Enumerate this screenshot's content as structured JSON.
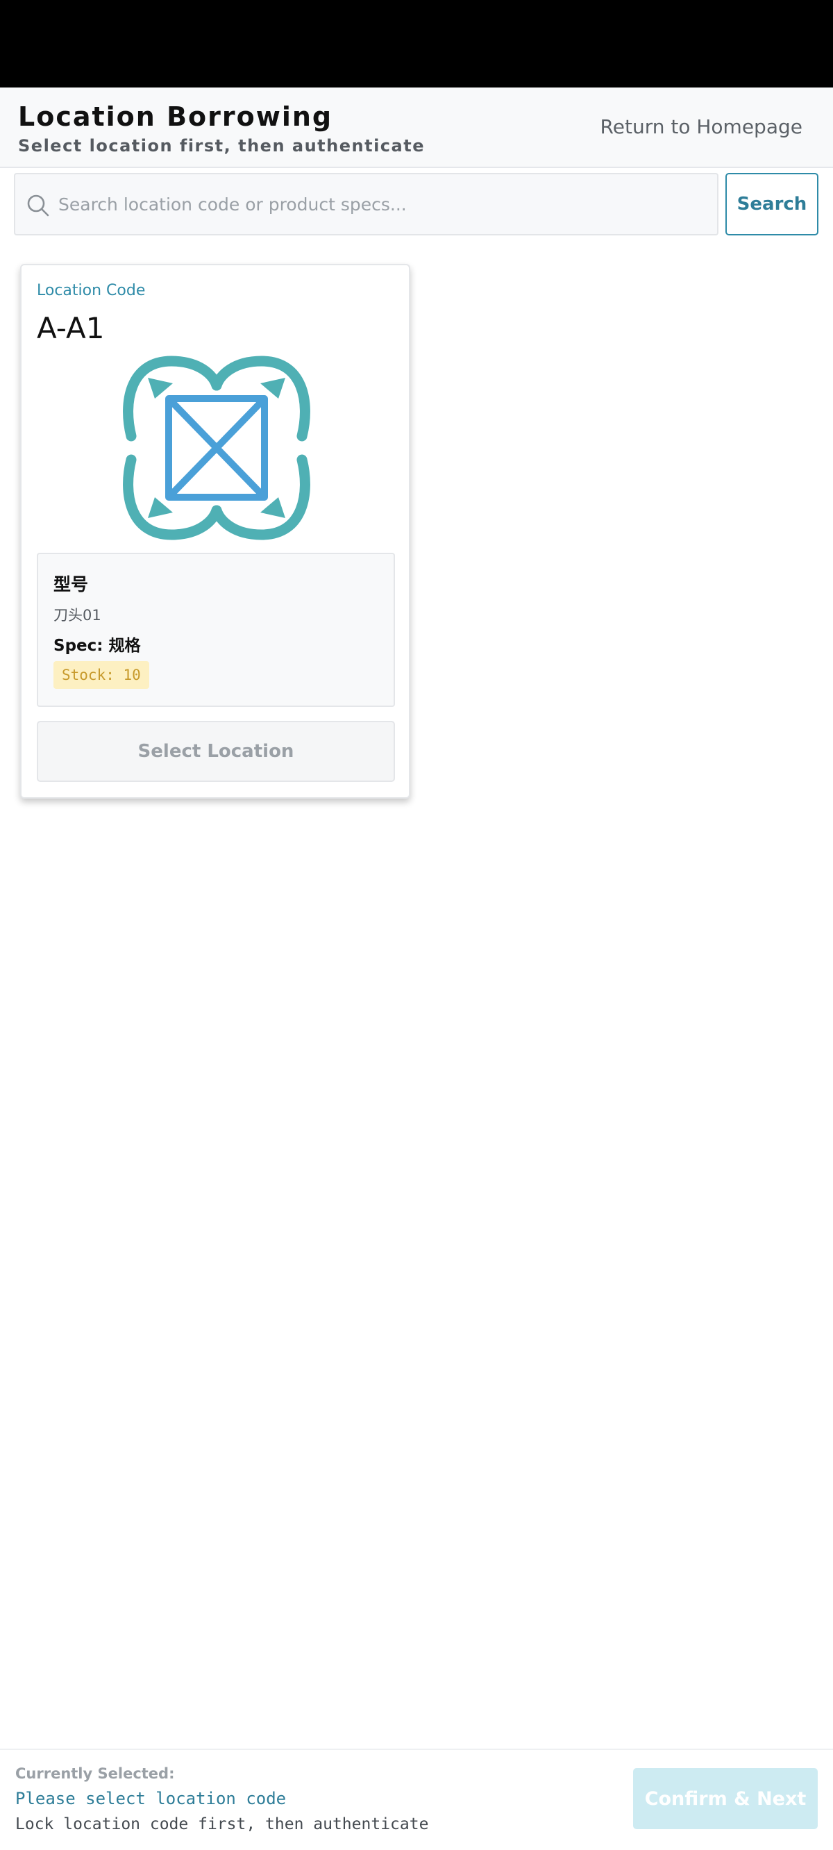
{
  "header": {
    "title": "Location Borrowing",
    "subtitle": "Select location first, then authenticate",
    "home_link": "Return to Homepage"
  },
  "search": {
    "placeholder": "Search location code or product specs...",
    "value": "",
    "button_label": "Search",
    "icon": "search-icon"
  },
  "locations": [
    {
      "label": "Location Code",
      "code": "A-A1",
      "image_icon": "product-logo-icon",
      "model_title": "型号",
      "model_value": "刀头01",
      "spec": "Spec: 规格",
      "stock": "Stock: 10",
      "select_label": "Select Location"
    }
  ],
  "footer": {
    "label": "Currently Selected:",
    "selected": "Please select location code",
    "hint": "Lock location code first, then authenticate",
    "confirm_label": "Confirm & Next"
  },
  "colors": {
    "accent": "#2e8ba8",
    "logo_teal": "#4fb0b4",
    "logo_blue": "#4aa0d8",
    "stock_bg": "#fdf0c2",
    "stock_text": "#c79a2c",
    "confirm_disabled": "#cdebf2"
  }
}
